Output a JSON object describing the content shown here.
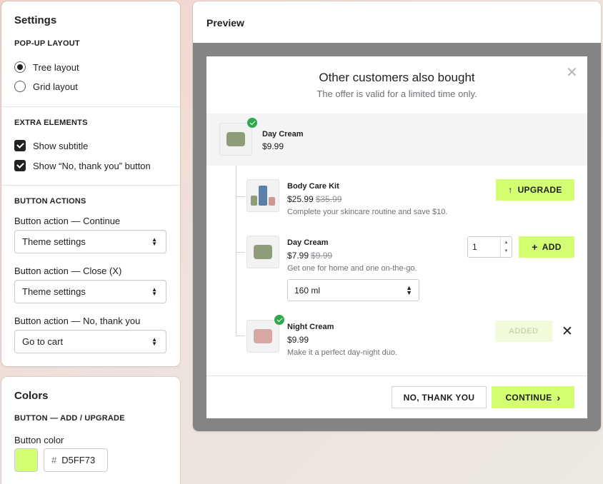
{
  "settings": {
    "title": "Settings",
    "layout_section": {
      "heading": "POP-UP LAYOUT",
      "options": [
        {
          "label": "Tree layout",
          "selected": true
        },
        {
          "label": "Grid layout",
          "selected": false
        }
      ]
    },
    "extra_section": {
      "heading": "EXTRA ELEMENTS",
      "options": [
        {
          "label": "Show subtitle",
          "checked": true
        },
        {
          "label": "Show “No, thank you” button",
          "checked": true
        }
      ]
    },
    "actions_section": {
      "heading": "BUTTON ACTIONS",
      "fields": [
        {
          "label": "Button action — Continue",
          "value": "Theme settings"
        },
        {
          "label": "Button action — Close (X)",
          "value": "Theme settings"
        },
        {
          "label": "Button action — No, thank you",
          "value": "Go to cart"
        }
      ]
    }
  },
  "colors": {
    "title": "Colors",
    "heading": "BUTTON — ADD / UPGRADE",
    "field_label": "Button color",
    "hash": "#",
    "hex_value": "D5FF73",
    "swatch_color": "#D5FF73"
  },
  "preview": {
    "title": "Preview",
    "modal": {
      "title": "Other customers also bought",
      "subtitle": "The offer is valid for a limited time only.",
      "close_glyph": "✕",
      "main_product": {
        "name": "Day Cream",
        "price": "$9.99"
      },
      "offers": [
        {
          "name": "Body Care Kit",
          "price": "$25.99",
          "compare_price": "$35.99",
          "description": "Complete your skincare routine and save $10.",
          "button": "UPGRADE",
          "button_icon": "↑"
        },
        {
          "name": "Day Cream",
          "price": "$7.99",
          "compare_price": "$9.99",
          "description": "Get one for home and one on-the-go.",
          "quantity": "1",
          "variant": "160 ml",
          "button": "ADD",
          "button_icon": "+"
        },
        {
          "name": "Night Cream",
          "price": "$9.99",
          "description": "Make it a perfect day-night duo.",
          "button": "ADDED",
          "remove_glyph": "✕"
        }
      ],
      "footer": {
        "decline": "NO, THANK YOU",
        "continue": "CONTINUE",
        "continue_icon": "›"
      }
    }
  }
}
